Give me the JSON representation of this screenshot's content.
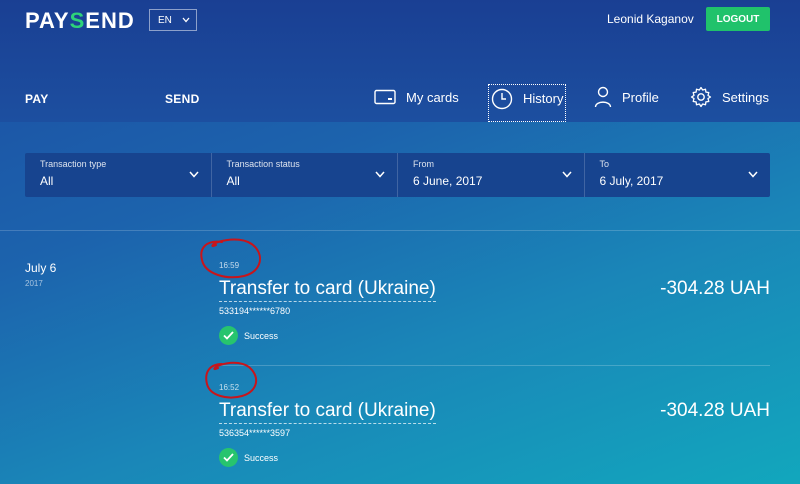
{
  "header": {
    "logo_main": "PAYSEND",
    "language": "EN",
    "user_name": "Leonid Kaganov",
    "logout_label": "LOGOUT"
  },
  "nav": {
    "pay": "PAY",
    "send": "SEND",
    "my_cards": "My cards",
    "history": "History",
    "profile": "Profile",
    "settings": "Settings"
  },
  "filters": [
    {
      "label": "Transaction type",
      "value": "All"
    },
    {
      "label": "Transaction status",
      "value": "All"
    },
    {
      "label": "From",
      "value": "6 June, 2017"
    },
    {
      "label": "To",
      "value": "6 July, 2017"
    }
  ],
  "history": {
    "date_day": "July 6",
    "date_year": "2017",
    "transactions": [
      {
        "time": "16:59",
        "title": "Transfer to card (Ukraine)",
        "card": "533194******6780",
        "amount": "-304.28 UAH",
        "status": "Success"
      },
      {
        "time": "16:52",
        "title": "Transfer to card (Ukraine)",
        "card": "536354******3597",
        "amount": "-304.28 UAH",
        "status": "Success"
      }
    ]
  },
  "colors": {
    "accent_green": "#20c26b",
    "annotation_red": "#c8151b"
  },
  "icons": [
    "chevron-down-icon",
    "card-icon",
    "clock-icon",
    "user-icon",
    "gear-icon",
    "check-icon"
  ]
}
